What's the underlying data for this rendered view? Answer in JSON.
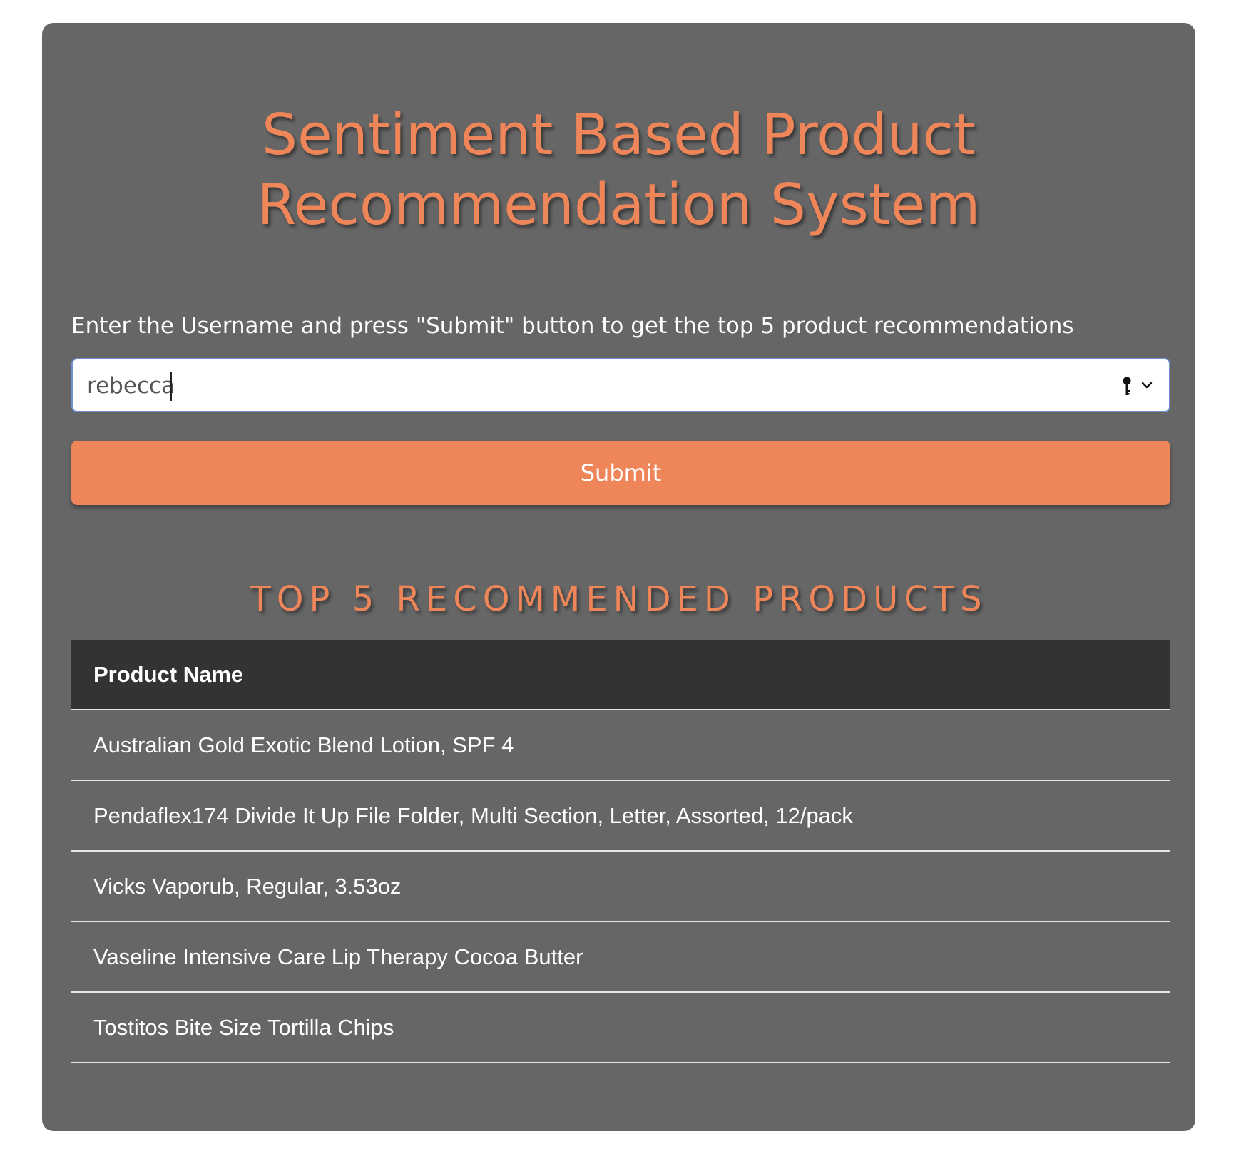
{
  "header": {
    "title_line1": "Sentiment Based Product",
    "title_line2": "Recommendation System"
  },
  "form": {
    "instructions": "Enter the Username and press \"Submit\" button to get the top 5 product recommendations",
    "username_value": "rebecca",
    "submit_label": "Submit"
  },
  "results": {
    "heading": "TOP 5 RECOMMENDED PRODUCTS",
    "column_header": "Product Name",
    "rows": [
      "Australian Gold Exotic Blend Lotion, SPF 4",
      "Pendaflex174 Divide It Up File Folder, Multi Section, Letter, Assorted, 12/pack",
      "Vicks Vaporub, Regular, 3.53oz",
      "Vaseline Intensive Care Lip Therapy Cocoa Butter",
      "Tostitos Bite Size Tortilla Chips"
    ]
  },
  "icons": {
    "autofill": "key-icon",
    "dropdown": "chevron-down-icon"
  },
  "colors": {
    "panel_background": "#666666",
    "accent": "#ee8659",
    "table_header_background": "#333333",
    "input_focus_border": "#6f8fd6"
  }
}
